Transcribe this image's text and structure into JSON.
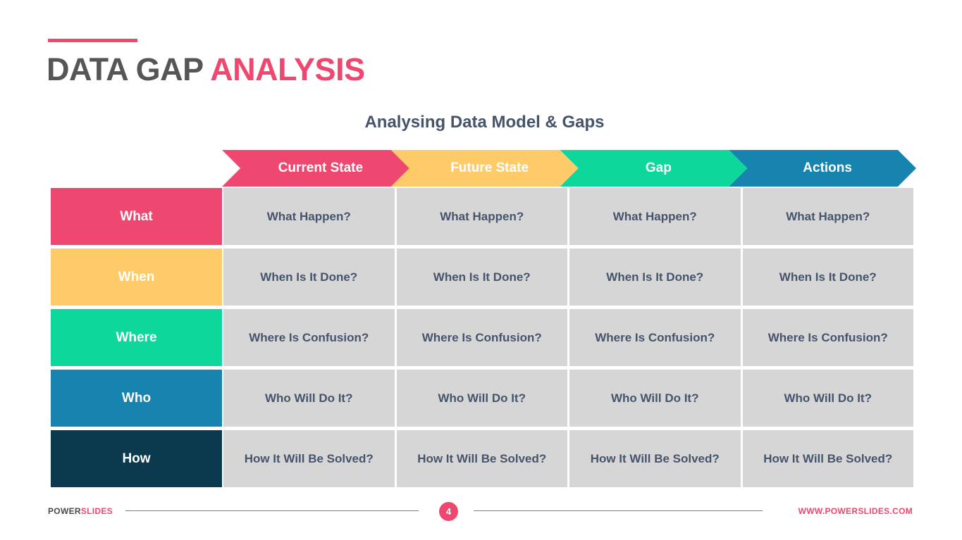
{
  "slide": {
    "title_part1": "DATA GAP",
    "title_part2": "ANALYSIS",
    "subtitle": "Analysing Data Model & Gaps"
  },
  "colors": {
    "accent_pink": "#ee4870",
    "yellow": "#ffcb69",
    "green": "#0ed79b",
    "blue": "#1684ae",
    "navy": "#0b3a4e",
    "title_dark": "#565656",
    "cell_bg": "#d6d6d6",
    "cell_text": "#46546b"
  },
  "columns": [
    {
      "label": "Current State",
      "color": "#ee4870"
    },
    {
      "label": "Future State",
      "color": "#ffcb69"
    },
    {
      "label": "Gap",
      "color": "#0ed79b"
    },
    {
      "label": "Actions",
      "color": "#1684ae"
    }
  ],
  "rows": [
    {
      "label": "What",
      "color": "#ee4870",
      "cells": [
        "What Happen?",
        "What Happen?",
        "What Happen?",
        "What Happen?"
      ]
    },
    {
      "label": "When",
      "color": "#ffcb69",
      "cells": [
        "When Is It Done?",
        "When Is It Done?",
        "When Is It Done?",
        "When Is It Done?"
      ]
    },
    {
      "label": "Where",
      "color": "#0ed79b",
      "cells": [
        "Where Is Confusion?",
        "Where Is Confusion?",
        "Where Is Confusion?",
        "Where Is Confusion?"
      ]
    },
    {
      "label": "Who",
      "color": "#1684ae",
      "cells": [
        "Who Will Do It?",
        "Who Will Do It?",
        "Who Will Do It?",
        "Who Will Do It?"
      ]
    },
    {
      "label": "How",
      "color": "#0b3a4e",
      "cells": [
        "How It Will Be Solved?",
        "How It Will Be Solved?",
        "How It Will Be Solved?",
        "How It Will Be Solved?"
      ]
    }
  ],
  "footer": {
    "brand_part1": "POWER",
    "brand_part2": "SLIDES",
    "page_number": "4",
    "site_url": "WWW.POWERSLIDES.COM"
  }
}
